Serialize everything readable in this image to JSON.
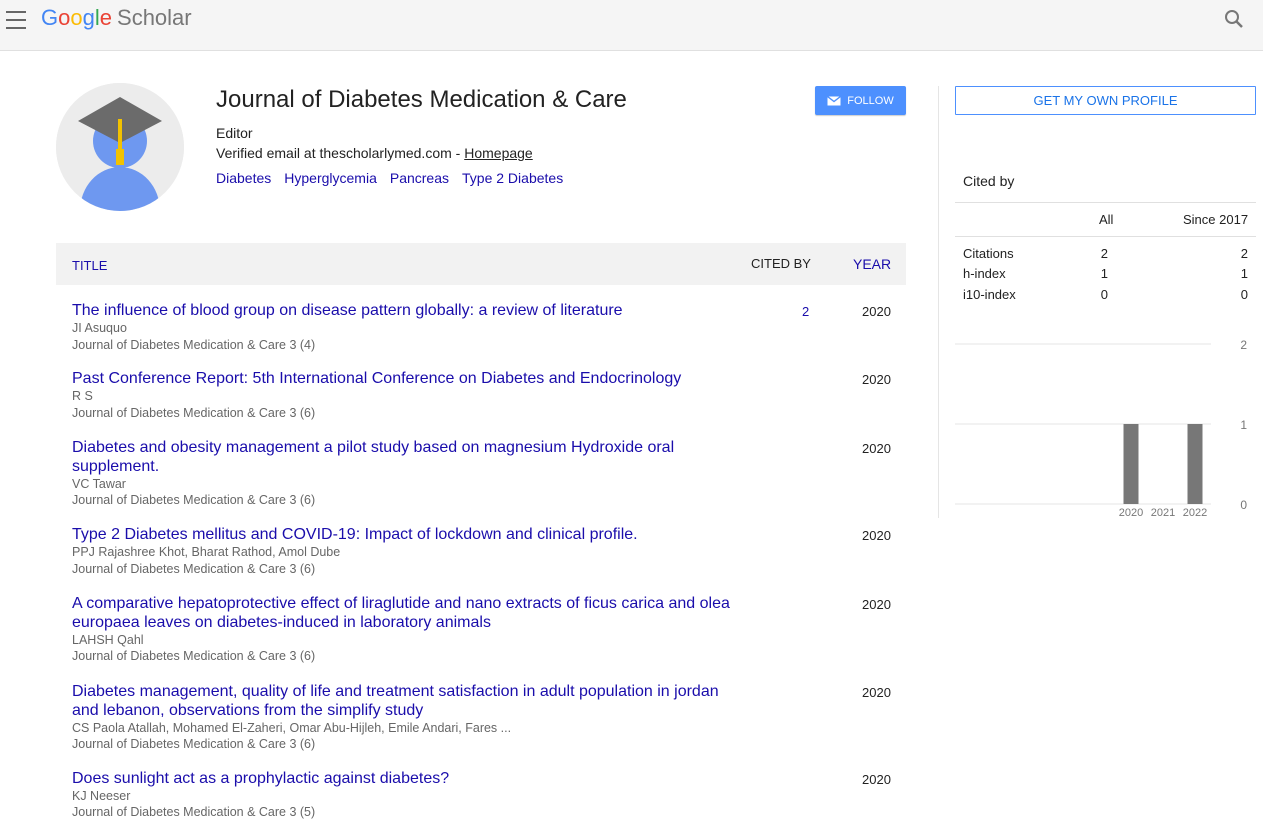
{
  "header": {
    "logo_letters": [
      "G",
      "o",
      "o",
      "g",
      "l",
      "e"
    ],
    "logo_product": "Scholar",
    "menu_icon": "hamburger-menu-icon",
    "search_icon": "search-icon"
  },
  "profile": {
    "name": "Journal of Diabetes Medication & Care",
    "affiliation": "Editor",
    "email_text": "Verified email at thescholarlymed.com - ",
    "homepage_label": "Homepage",
    "interests": [
      "Diabetes",
      "Hyperglycemia",
      "Pancreas",
      "Type 2 Diabetes"
    ],
    "follow_label": "FOLLOW"
  },
  "table": {
    "col_title": "TITLE",
    "col_cited": "CITED BY",
    "col_year": "YEAR",
    "rows": [
      {
        "title": "The influence of blood group on disease pattern globally: a review of literature",
        "authors": "JI Asuquo",
        "venue": "Journal of Diabetes Medication & Care 3 (4)",
        "cited": "2",
        "year": "2020"
      },
      {
        "title": "Past Conference Report: 5th International Conference on Diabetes and Endocrinology",
        "authors": "R S",
        "venue": "Journal of Diabetes Medication & Care 3 (6)",
        "cited": "",
        "year": "2020"
      },
      {
        "title": "Diabetes and obesity management a pilot study based on magnesium Hydroxide oral supplement.",
        "authors": "VC Tawar",
        "venue": "Journal of Diabetes Medication & Care 3 (6)",
        "cited": "",
        "year": "2020"
      },
      {
        "title": "Type 2 Diabetes mellitus and COVID-19: Impact of lockdown and clinical profile.",
        "authors": "PPJ Rajashree Khot, Bharat Rathod, Amol Dube",
        "venue": "Journal of Diabetes Medication & Care 3 (6)",
        "cited": "",
        "year": "2020"
      },
      {
        "title": "A comparative hepatoprotective effect of liraglutide and nano extracts of ficus carica and olea europaea leaves on diabetes-induced in laboratory animals",
        "authors": "LAHSH Qahl",
        "venue": "Journal of Diabetes Medication & Care 3 (6)",
        "cited": "",
        "year": "2020"
      },
      {
        "title": "Diabetes management, quality of life and treatment satisfaction in adult population in jordan and lebanon, observations from the simplify study",
        "authors": "CS Paola Atallah, Mohamed El-Zaheri, Omar Abu-Hijleh, Emile Andari, Fares ...",
        "venue": "Journal of Diabetes Medication & Care 3 (6)",
        "cited": "",
        "year": "2020"
      },
      {
        "title": "Does sunlight act as a prophylactic against diabetes?",
        "authors": "KJ Neeser",
        "venue": "Journal of Diabetes Medication & Care 3 (5)",
        "cited": "",
        "year": "2020"
      }
    ]
  },
  "sidebar": {
    "own_profile_label": "GET MY OWN PROFILE",
    "cited_by_label": "Cited by",
    "col_all": "All",
    "col_since": "Since 2017",
    "stats": [
      {
        "label": "Citations",
        "all": "2",
        "since": "2"
      },
      {
        "label": "h-index",
        "all": "1",
        "since": "1"
      },
      {
        "label": "i10-index",
        "all": "0",
        "since": "0"
      }
    ]
  },
  "chart_data": {
    "type": "bar",
    "categories": [
      "2020",
      "2021",
      "2022"
    ],
    "values": [
      1,
      0,
      1
    ],
    "ylim": [
      0,
      2
    ],
    "yticks": [
      "0",
      "1",
      "2"
    ],
    "bar_color": "#777777",
    "grid": true
  }
}
